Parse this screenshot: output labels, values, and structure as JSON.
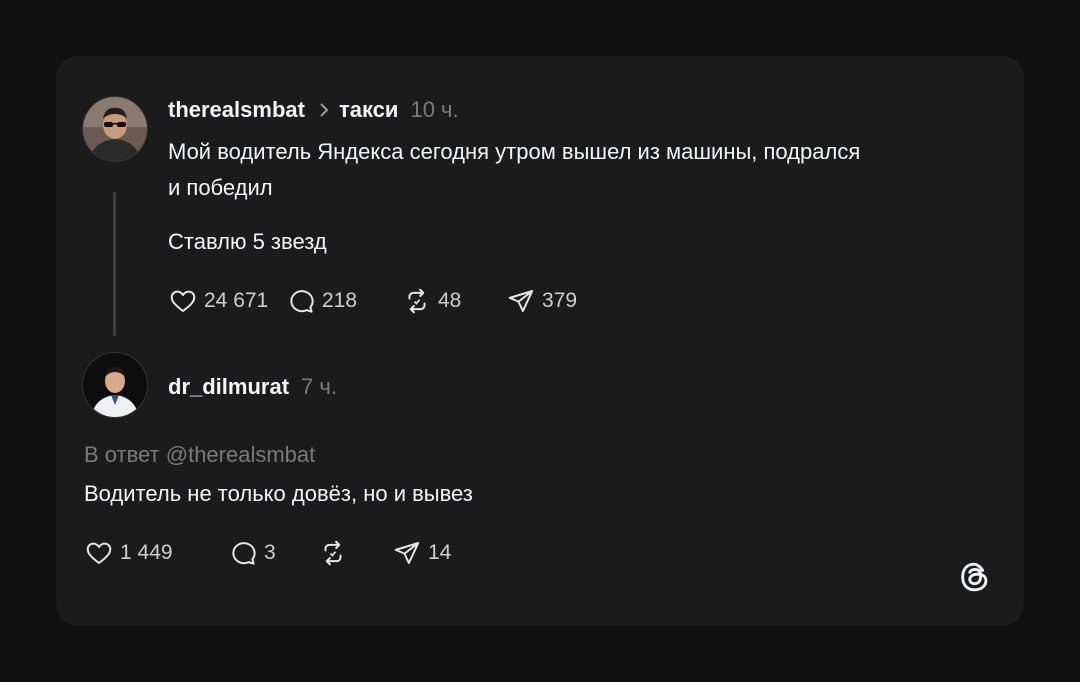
{
  "post": {
    "username": "therealsmbat",
    "topic": "такси",
    "time": "10 ч.",
    "text_line1": "Мой водитель Яндекса сегодня утром вышел из машины, подрался",
    "text_line2": "и победил",
    "text_line3": "Ставлю 5 звезд",
    "likes": "24 671",
    "comments": "218",
    "reposts": "48",
    "shares": "379"
  },
  "reply": {
    "username": "dr_dilmurat",
    "time": "7 ч.",
    "reply_to": "В ответ @therealsmbat",
    "text": "Водитель не только довёз, но и вывез",
    "likes": "1 449",
    "comments": "3",
    "shares": "14"
  },
  "icons": {
    "like": "heart-icon",
    "comment": "comment-bubble-icon",
    "repost": "repost-icon",
    "share": "send-icon",
    "logo": "threads-logo-icon"
  },
  "colors": {
    "background": "#111111",
    "card": "#1b1b1b",
    "text": "#f3f5f7",
    "muted": "#7a7a7a"
  }
}
